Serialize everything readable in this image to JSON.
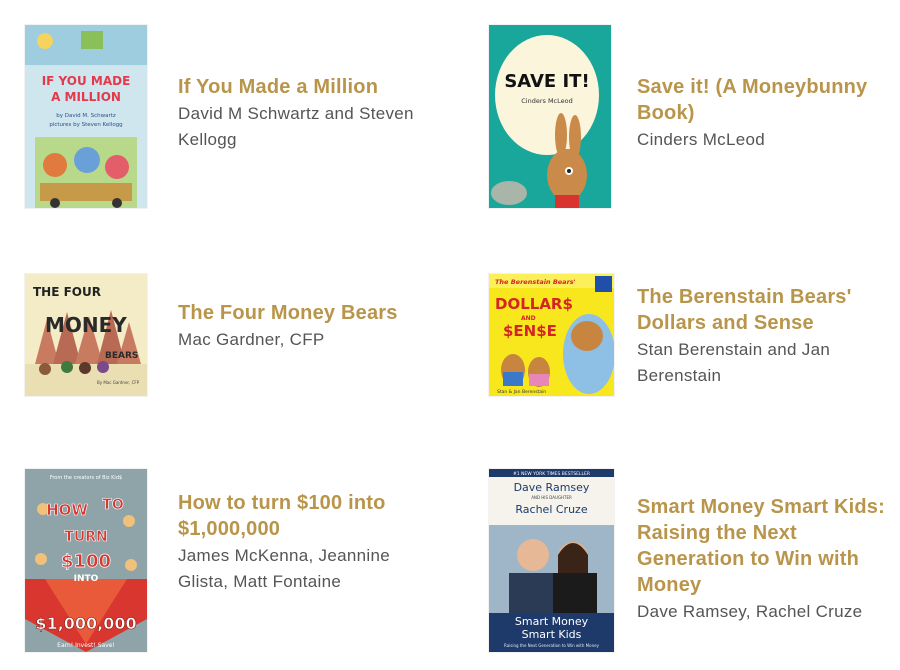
{
  "colors": {
    "title": "#b8954a",
    "author": "#555555"
  },
  "books": [
    {
      "title": "If You Made a Million",
      "author": "David M Schwartz and Steven Kellogg",
      "cover": {
        "line1": "IF YOU MADE",
        "line2": "A MILLION",
        "byline": "by David M. Schwartz",
        "illus": "pictures by Steven Kellogg"
      }
    },
    {
      "title": "Save it! (A Moneybunny Book)",
      "author": "Cinders McLeod",
      "cover": {
        "headline": "SAVE IT!",
        "byline": "Cinders McLeod"
      }
    },
    {
      "title": "The Four Money Bears",
      "author": "Mac Gardner, CFP",
      "cover": {
        "line1": "THE FOUR",
        "line2": "MONEY",
        "line3": "BEARS",
        "byline": "By Mac Gardner, CFP"
      }
    },
    {
      "title": "The Berenstain Bears' Dollars and Sense",
      "author": "Stan Berenstain and Jan Berenstain",
      "cover": {
        "series": "The Berenstain Bears'",
        "line1": "DOLLAR$",
        "and": "AND",
        "line2": "$EN$E",
        "byline": "Stan & Jan Berenstain"
      }
    },
    {
      "title": "How to turn $100 into $1,000,000",
      "author": "James McKenna, Jeannine Glista, Matt Fontaine",
      "cover": {
        "top": "From the creators of Biz Kid$",
        "w1": "HOW",
        "w2": "TO",
        "w3": "TURN",
        "w4": "$100",
        "w5": "INTO",
        "amount": "$1,000,000",
        "tagline": "Earn! Invest! Save!"
      }
    },
    {
      "title": "Smart Money Smart Kids: Raising the Next Generation to Win with Money",
      "author": "Dave Ramsey, Rachel Cruze",
      "cover": {
        "banner": "#1 NEW YORK TIMES BESTSELLER",
        "name1": "Dave Ramsey",
        "and": "AND HIS DAUGHTER",
        "name2": "Rachel Cruze",
        "t1": "Smart Money",
        "t2": "Smart Kids",
        "sub": "Raising the Next Generation to Win with Money"
      }
    }
  ]
}
